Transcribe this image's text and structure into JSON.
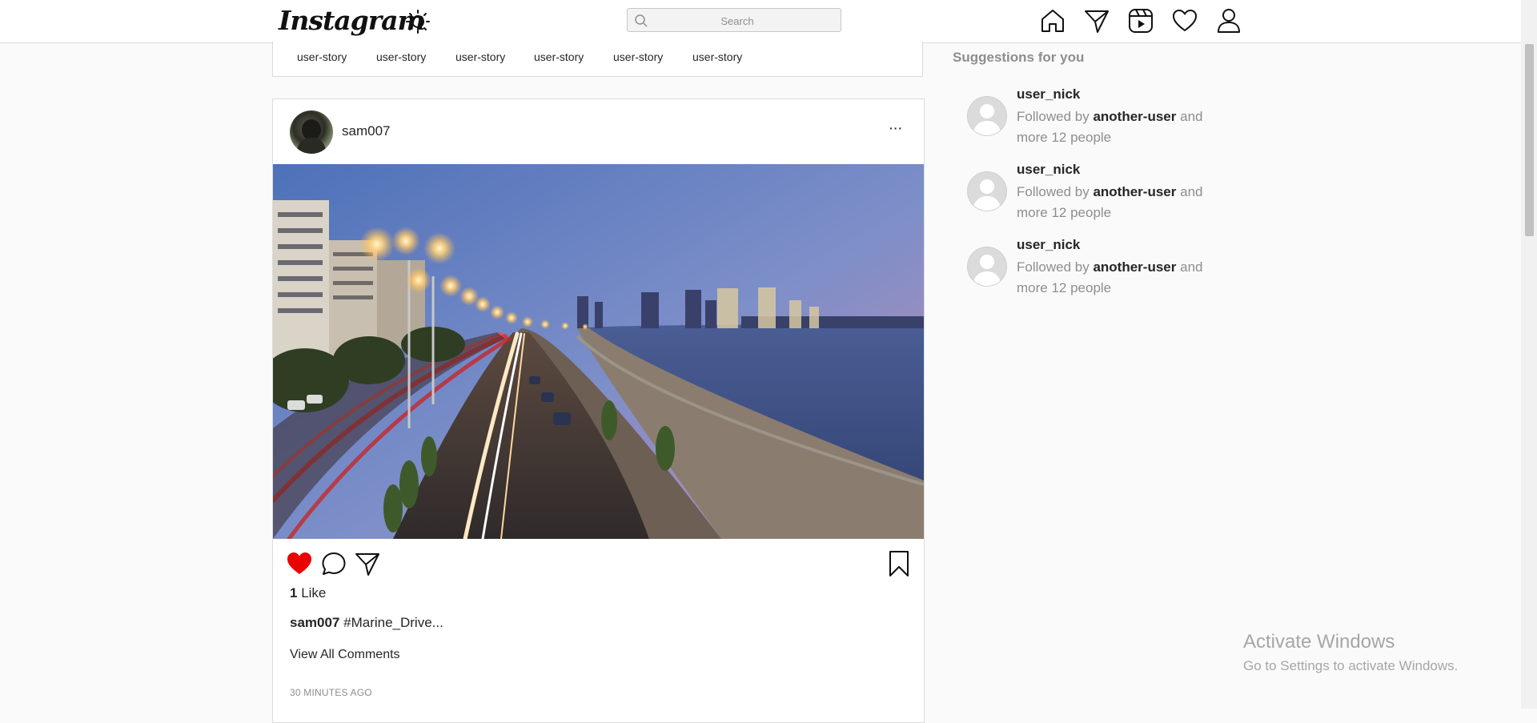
{
  "header": {
    "logo": "Instagram",
    "search_placeholder": "Search",
    "icons": [
      "home-icon",
      "send-icon",
      "reels-icon",
      "heart-icon",
      "profile-icon"
    ],
    "theme_icon": "sun-icon"
  },
  "stories": [
    "user-story",
    "user-story",
    "user-story",
    "user-story",
    "user-story",
    "user-story"
  ],
  "post": {
    "username": "sam007",
    "more": "···",
    "likes_count": "1",
    "likes_label": "Like",
    "caption_user": "sam007",
    "caption_text": "#Marine_Drive...",
    "view_comments": "View All Comments",
    "time": "30 MINUTES AGO",
    "liked": true,
    "like_color": "#ed0000"
  },
  "suggestions": {
    "title": "Suggestions for you",
    "items": [
      {
        "name": "user_nick",
        "prefix": "Followed by",
        "follower": "another-user",
        "suffix": "and more 12 people"
      },
      {
        "name": "user_nick",
        "prefix": "Followed by",
        "follower": "another-user",
        "suffix": "and more 12 people"
      },
      {
        "name": "user_nick",
        "prefix": "Followed by",
        "follower": "another-user",
        "suffix": "and more 12 people"
      }
    ]
  },
  "watermark": {
    "title": "Activate Windows",
    "subtitle": "Go to Settings to activate Windows."
  }
}
